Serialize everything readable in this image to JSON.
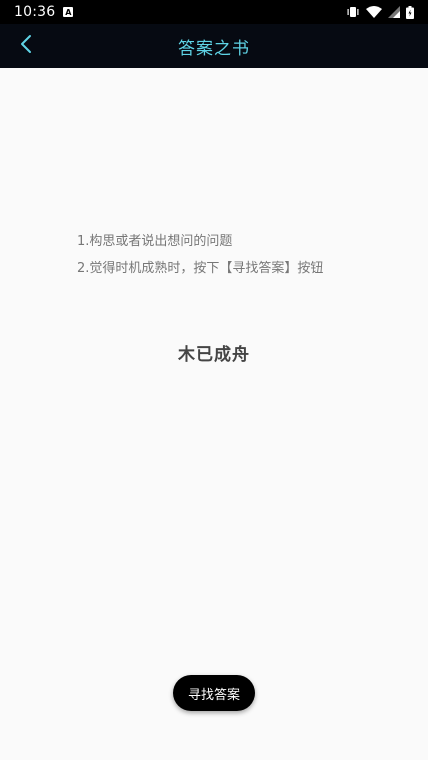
{
  "status_bar": {
    "time": "10:36",
    "notification_icon": "a-icon",
    "icons": [
      "vibrate-icon",
      "wifi-icon",
      "signal-icon",
      "battery-icon"
    ]
  },
  "app_bar": {
    "title": "答案之书",
    "back_icon": "chevron-left-icon",
    "background": "#060a12",
    "title_color": "#5fd4e6"
  },
  "instructions": {
    "line1": "1.构思或者说出想问的问题",
    "line2": "2.觉得时机成熟时，按下【寻找答案】按钮"
  },
  "answer": {
    "text": "木已成舟"
  },
  "find_button": {
    "label": "寻找答案"
  }
}
